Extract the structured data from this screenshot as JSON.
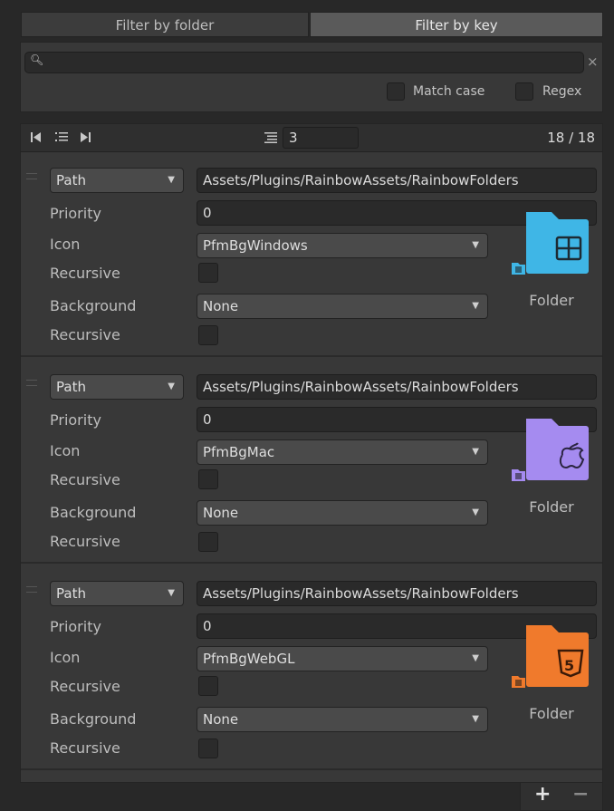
{
  "tabs": {
    "folder_label": "Filter by folder",
    "key_label": "Filter by key"
  },
  "search": {
    "value": "",
    "match_case_label": "Match case",
    "regex_label": "Regex"
  },
  "list": {
    "page_size": "3",
    "count_text": "18 / 18"
  },
  "entries": [
    {
      "key_type": "Path",
      "path": "Assets/Plugins/RainbowAssets/RainbowFolders",
      "priority_label": "Priority",
      "priority": "0",
      "icon_label": "Icon",
      "icon": "PfmBgWindows",
      "recursive_label": "Recursive",
      "background_label": "Background",
      "background": "None",
      "recursive2_label": "Recursive",
      "preview_caption": "Folder",
      "preview_icon": "windows-folder-icon",
      "preview_color": "#3fb6e6"
    },
    {
      "key_type": "Path",
      "path": "Assets/Plugins/RainbowAssets/RainbowFolders",
      "priority_label": "Priority",
      "priority": "0",
      "icon_label": "Icon",
      "icon": "PfmBgMac",
      "recursive_label": "Recursive",
      "background_label": "Background",
      "background": "None",
      "recursive2_label": "Recursive",
      "preview_caption": "Folder",
      "preview_icon": "apple-folder-icon",
      "preview_color": "#a58bf0"
    },
    {
      "key_type": "Path",
      "path": "Assets/Plugins/RainbowAssets/RainbowFolders",
      "priority_label": "Priority",
      "priority": "0",
      "icon_label": "Icon",
      "icon": "PfmBgWebGL",
      "recursive_label": "Recursive",
      "background_label": "Background",
      "background": "None",
      "recursive2_label": "Recursive",
      "preview_caption": "Folder",
      "preview_icon": "html5-folder-icon",
      "preview_color": "#f07a2c"
    }
  ],
  "footer": {
    "add_label": "+",
    "remove_label": "−"
  }
}
